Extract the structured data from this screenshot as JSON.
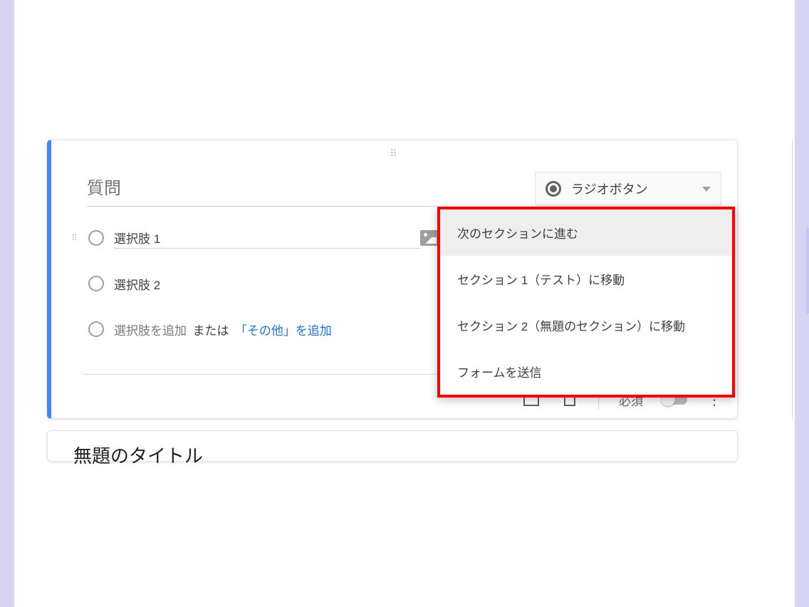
{
  "question": {
    "placeholder": "質問"
  },
  "qtype": {
    "label": "ラジオボタン"
  },
  "options": {
    "opt1": "選択肢 1",
    "opt2": "選択肢 2",
    "add_placeholder": "選択肢を追加",
    "or_word": "または",
    "add_other": "「その他」を追加"
  },
  "dropdown_items": {
    "i0": "次のセクションに進む",
    "i1": "セクション 1（テスト）に移動",
    "i2": "セクション 2（無題のセクション）に移動",
    "i3": "フォームを送信"
  },
  "footer": {
    "required_label": "必須"
  },
  "next_section": {
    "title": "無題のタイトル"
  }
}
